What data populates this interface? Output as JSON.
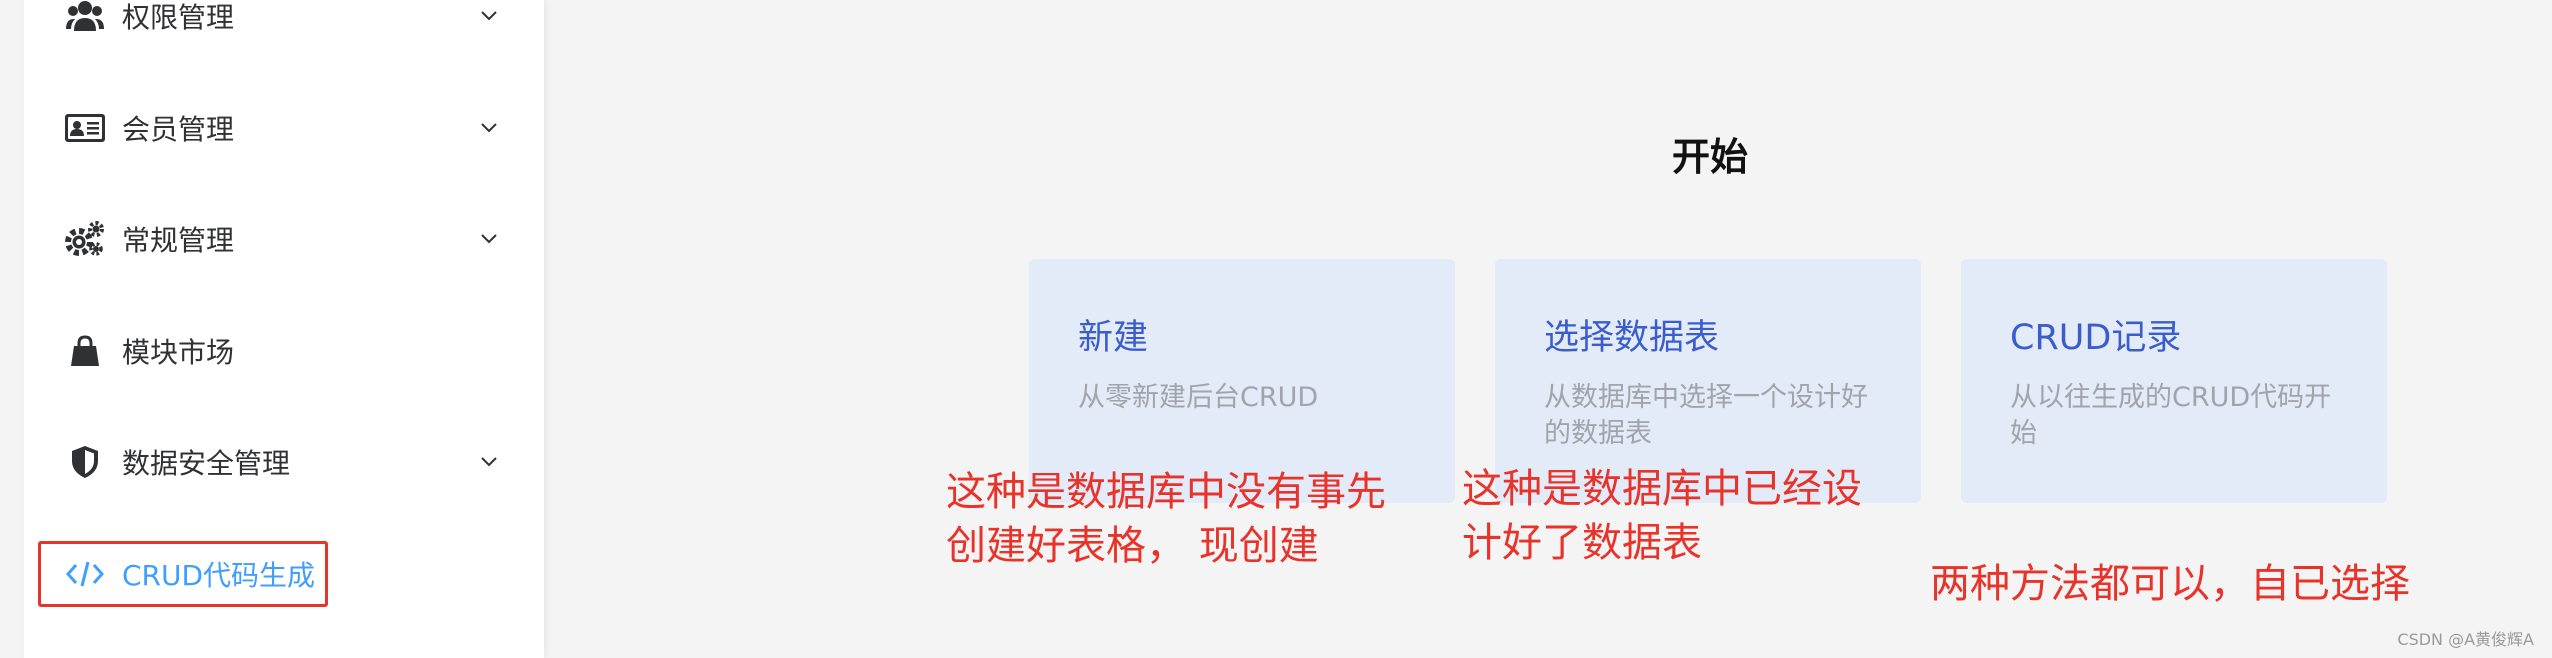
{
  "sidebar": {
    "items": [
      {
        "label": "权限管理",
        "icon": "users-icon",
        "has_chevron": true
      },
      {
        "label": "会员管理",
        "icon": "id-card-icon",
        "has_chevron": true
      },
      {
        "label": "常规管理",
        "icon": "gears-icon",
        "has_chevron": true
      },
      {
        "label": "模块市场",
        "icon": "shopping-bag-icon",
        "has_chevron": false
      },
      {
        "label": "数据安全管理",
        "icon": "shield-icon",
        "has_chevron": true
      },
      {
        "label": "CRUD代码生成",
        "icon": "code-icon",
        "has_chevron": false,
        "active": true
      }
    ]
  },
  "main": {
    "title": "开始",
    "cards": [
      {
        "title": "新建",
        "desc": "从零新建后台CRUD"
      },
      {
        "title": "选择数据表",
        "desc": "从数据库中选择一个设计好的数据表"
      },
      {
        "title": "CRUD记录",
        "desc": "从以往生成的CRUD代码开始"
      }
    ]
  },
  "annotations": {
    "note1_line1": "这种是数据库中没有事先",
    "note1_line2": "创建好表格， 现创建",
    "note2_line1": "这种是数据库中已经设",
    "note2_line2": "计好了数据表",
    "note3": "两种方法都可以，自已选择"
  },
  "watermark": "CSDN @A黄俊辉A",
  "colors": {
    "active": "#409eff",
    "card_bg": "#e3ebf9",
    "card_title": "#3b5dcc",
    "annotation": "#e8332b",
    "background": "#f4f4f4"
  }
}
